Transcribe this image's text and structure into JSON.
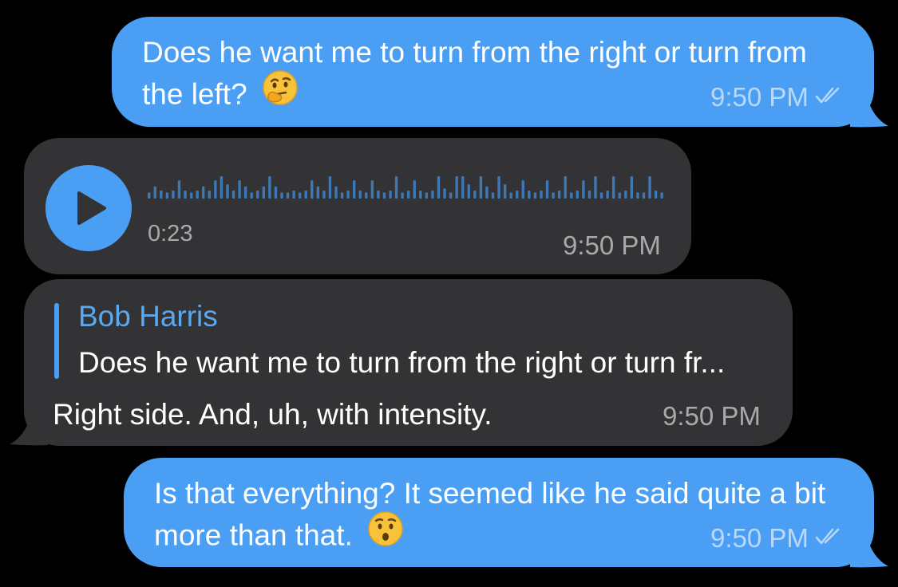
{
  "messages": [
    {
      "direction": "outgoing",
      "line1": "Does he want me to turn from the right or turn from",
      "line2": "the left?",
      "emoji": "thinking-face",
      "time": "9:50 PM",
      "status": "read"
    },
    {
      "direction": "incoming",
      "type": "voice",
      "duration": "0:23",
      "time": "9:50 PM"
    },
    {
      "direction": "incoming",
      "reply_to": {
        "name": "Bob Harris",
        "text": "Does he want me to turn from the right or turn fr..."
      },
      "text": "Right side. And, uh, with intensity.",
      "time": "9:50 PM"
    },
    {
      "direction": "outgoing",
      "line1": "Is that everything? It seemed like he said quite a bit",
      "line2": "more than that.",
      "emoji": "hushed-face",
      "time": "9:50 PM",
      "status": "read"
    }
  ],
  "colors": {
    "background": "#000000",
    "outgoing_bubble": "#4a9ff5",
    "incoming_bubble": "#333335",
    "accent": "#4a9ff5"
  },
  "waveform_levels": [
    3,
    6,
    4,
    3,
    4,
    9,
    4,
    3,
    4,
    6,
    4,
    9,
    11,
    7,
    4,
    9,
    6,
    3,
    4,
    6,
    11,
    6,
    3,
    3,
    4,
    3,
    4,
    9,
    6,
    4,
    11,
    6,
    3,
    4,
    9,
    4,
    3,
    9,
    4,
    3,
    4,
    11,
    3,
    4,
    9,
    4,
    3,
    4,
    11,
    5,
    3,
    11,
    11,
    7,
    4,
    11,
    6,
    3,
    11,
    7,
    3,
    4,
    9,
    4,
    3,
    4,
    9,
    3,
    4,
    11,
    3,
    4,
    9,
    4,
    11,
    3,
    4,
    11,
    3,
    4,
    11,
    3,
    3,
    11,
    4,
    3
  ]
}
